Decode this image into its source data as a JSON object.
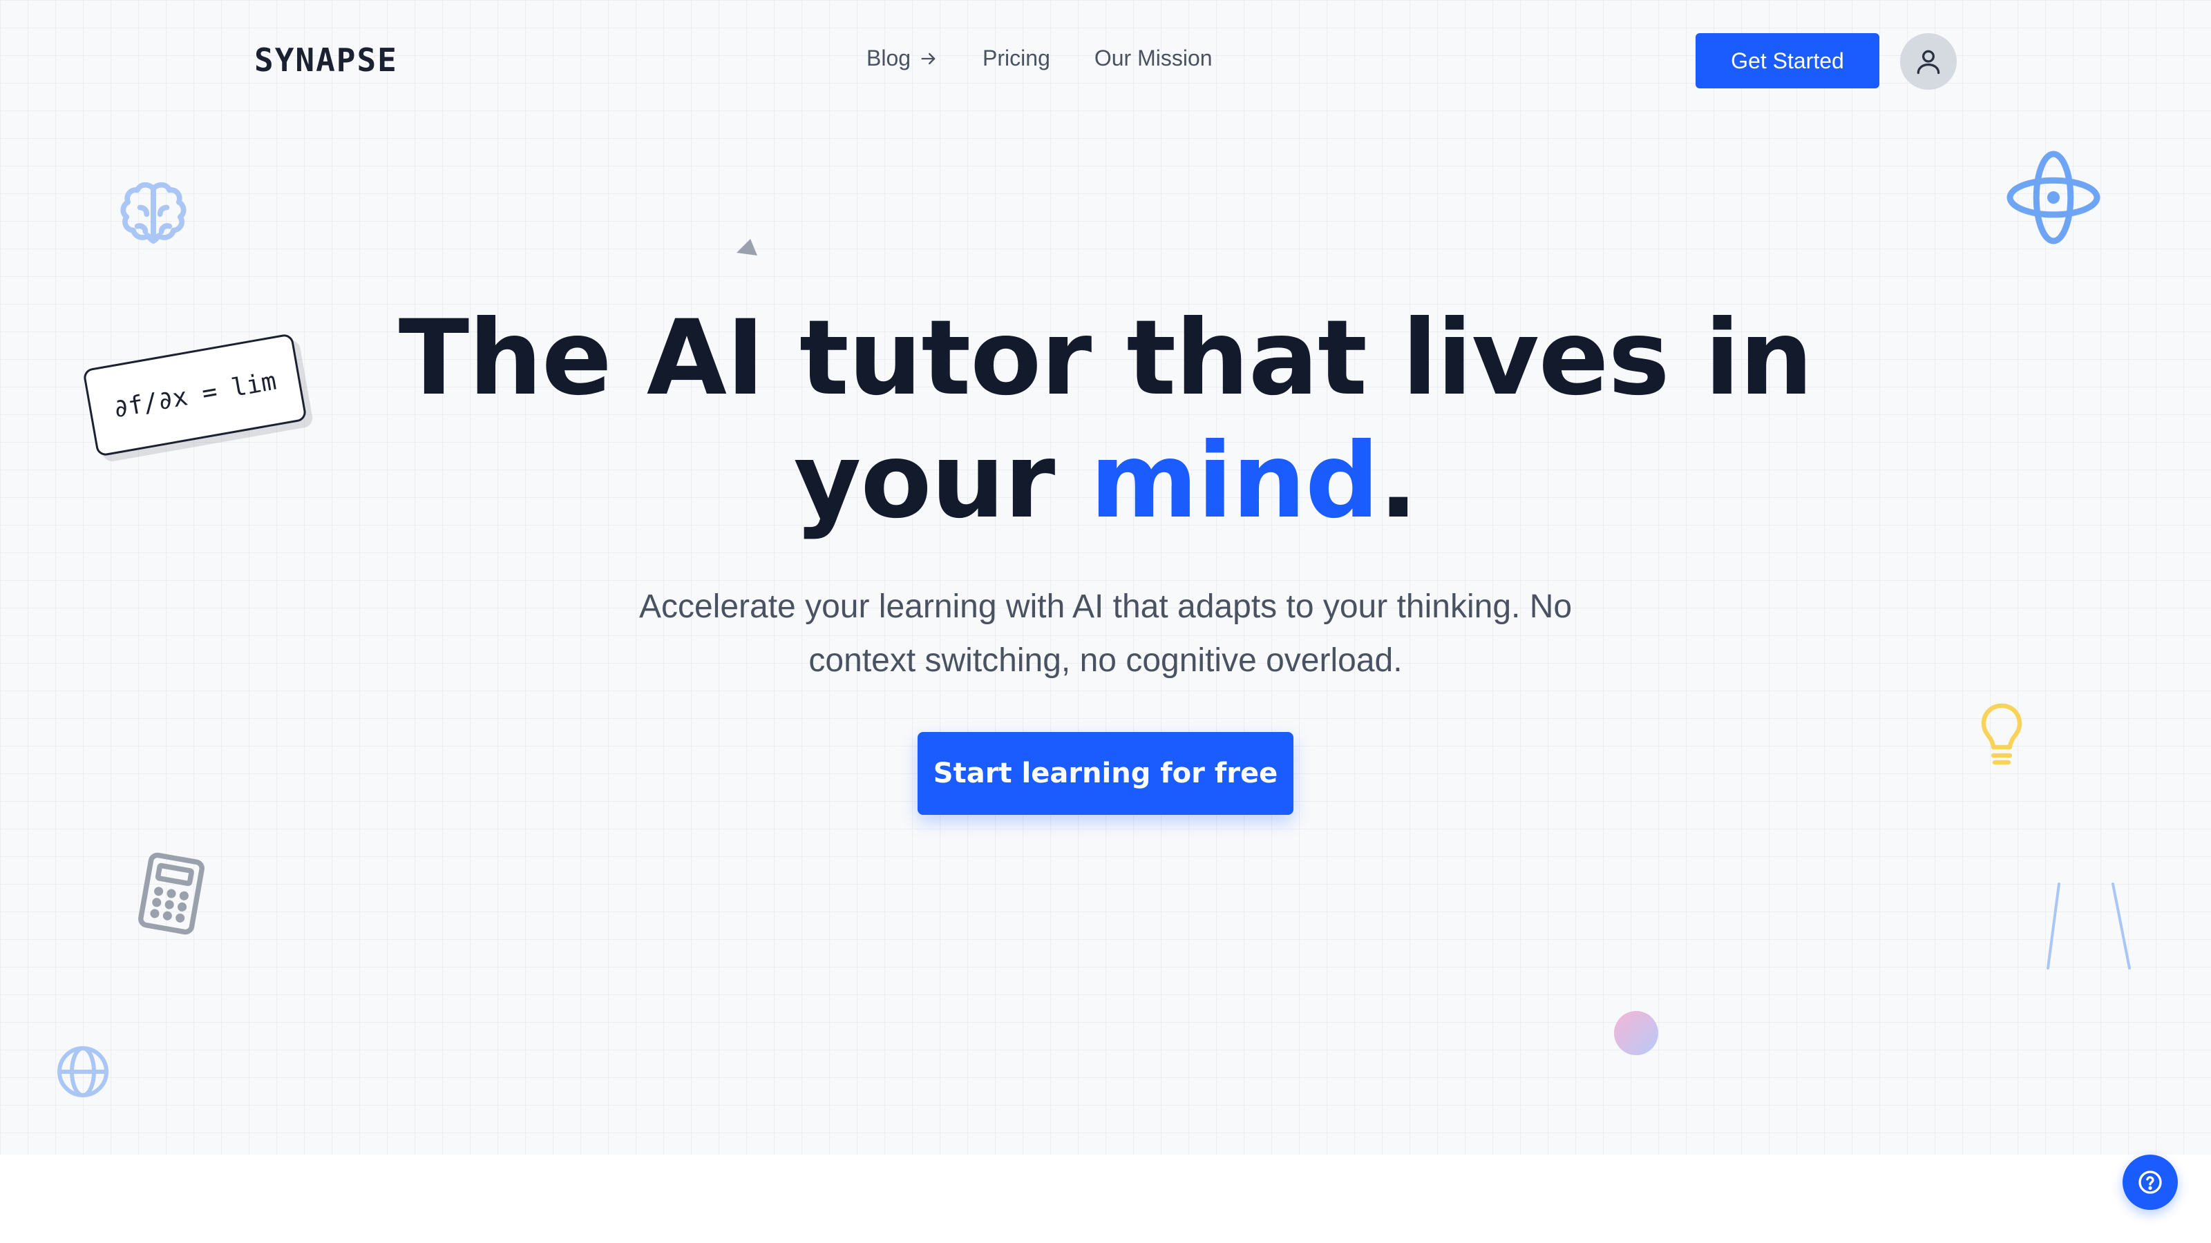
{
  "brand": {
    "logo_text": "SYNAPSE"
  },
  "nav": {
    "links": [
      {
        "label": "Blog",
        "icon": "arrow-right-icon"
      },
      {
        "label": "Pricing"
      },
      {
        "label": "Our Mission"
      }
    ],
    "cta_label": "Get Started",
    "avatar_icon": "user-icon"
  },
  "hero": {
    "headline_line1": "The AI tutor that lives in",
    "headline_line2_prefix": "your ",
    "headline_accent": "mind",
    "headline_suffix": ".",
    "subheadline_line1": "Accelerate your learning with AI that adapts to your thinking. No",
    "subheadline_line2": "context switching, no cognitive overload.",
    "cta_label": "Start learning for free"
  },
  "decor": {
    "formula_text": "∂f/∂x = lim",
    "icons": [
      "brain-icon",
      "atom-icon",
      "triangle-icon",
      "lightbulb-icon",
      "calculator-icon",
      "globe-icon",
      "gradient-dot",
      "ruler-lines"
    ]
  },
  "help": {
    "icon": "question-circle-icon"
  },
  "colors": {
    "accent": "#1b5cff",
    "headline": "#131a2b",
    "body_text": "#4a5262",
    "background": "#f8f9fb",
    "lightbulb": "#f7d35a",
    "icon_blue_light": "#a9c6f5"
  }
}
